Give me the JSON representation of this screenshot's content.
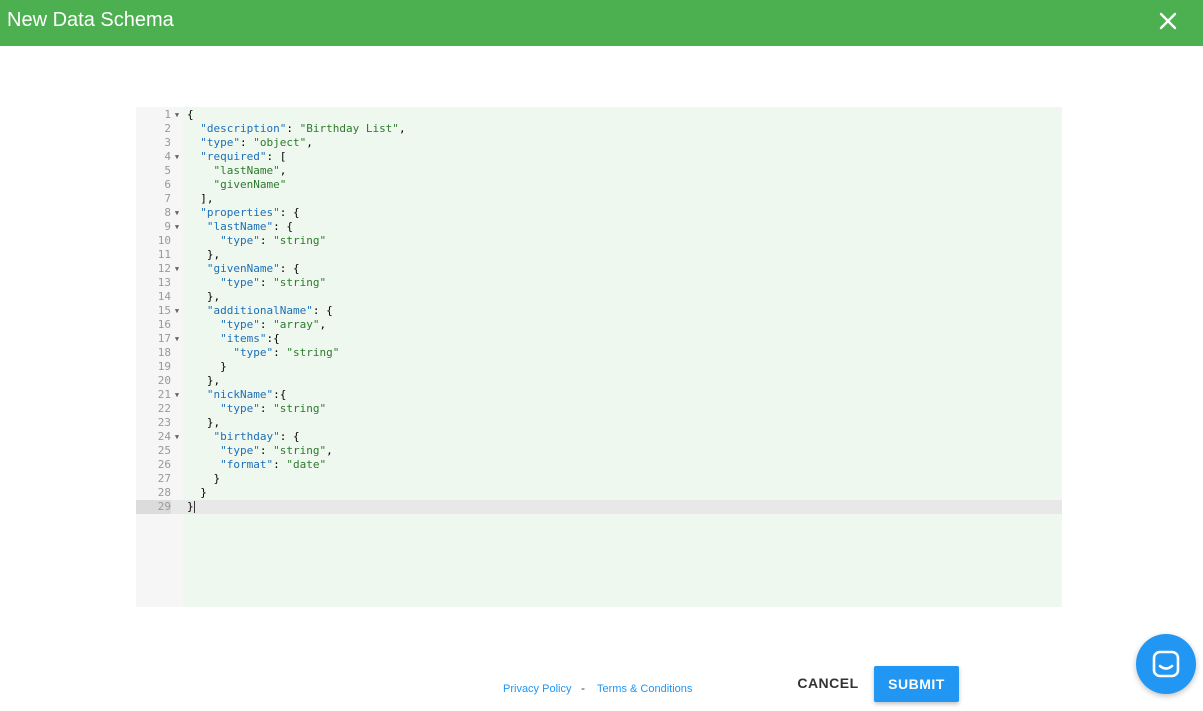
{
  "header": {
    "title": "New Data Schema",
    "close_icon": "close-icon"
  },
  "editor": {
    "line_numbers": [
      "1",
      "2",
      "3",
      "4",
      "5",
      "6",
      "7",
      "8",
      "9",
      "10",
      "11",
      "12",
      "13",
      "14",
      "15",
      "16",
      "17",
      "18",
      "19",
      "20",
      "21",
      "22",
      "23",
      "24",
      "25",
      "26",
      "27",
      "28",
      "29"
    ],
    "folding_lines": [
      1,
      4,
      8,
      9,
      12,
      15,
      17,
      21,
      24
    ],
    "active_line": 29,
    "lines": [
      "{",
      "  \"description\": \"Birthday List\",",
      "  \"type\": \"object\",",
      "  \"required\": [",
      "    \"lastName\",",
      "    \"givenName\"",
      "  ],",
      "  \"properties\": {",
      "   \"lastName\": {",
      "     \"type\": \"string\"",
      "   },",
      "   \"givenName\": {",
      "     \"type\": \"string\"",
      "   },",
      "   \"additionalName\": {",
      "     \"type\": \"array\",",
      "     \"items\":{",
      "       \"type\": \"string\"",
      "     }",
      "   },",
      "   \"nickName\":{",
      "     \"type\": \"string\"",
      "   },",
      "    \"birthday\": {",
      "     \"type\": \"string\",",
      "     \"format\": \"date\"",
      "    }",
      "  }",
      "}"
    ]
  },
  "footer": {
    "privacy_label": "Privacy Policy",
    "separator": "-",
    "terms_label": "Terms & Conditions"
  },
  "actions": {
    "cancel_label": "CANCEL",
    "submit_label": "SUBMIT"
  },
  "chat": {
    "icon": "chat-icon"
  },
  "colors": {
    "header": "#4caf50",
    "primary": "#2196f3",
    "editor_bg": "#eff8ef",
    "json_key": "#1d6fb8",
    "json_string": "#2b7a2b"
  }
}
